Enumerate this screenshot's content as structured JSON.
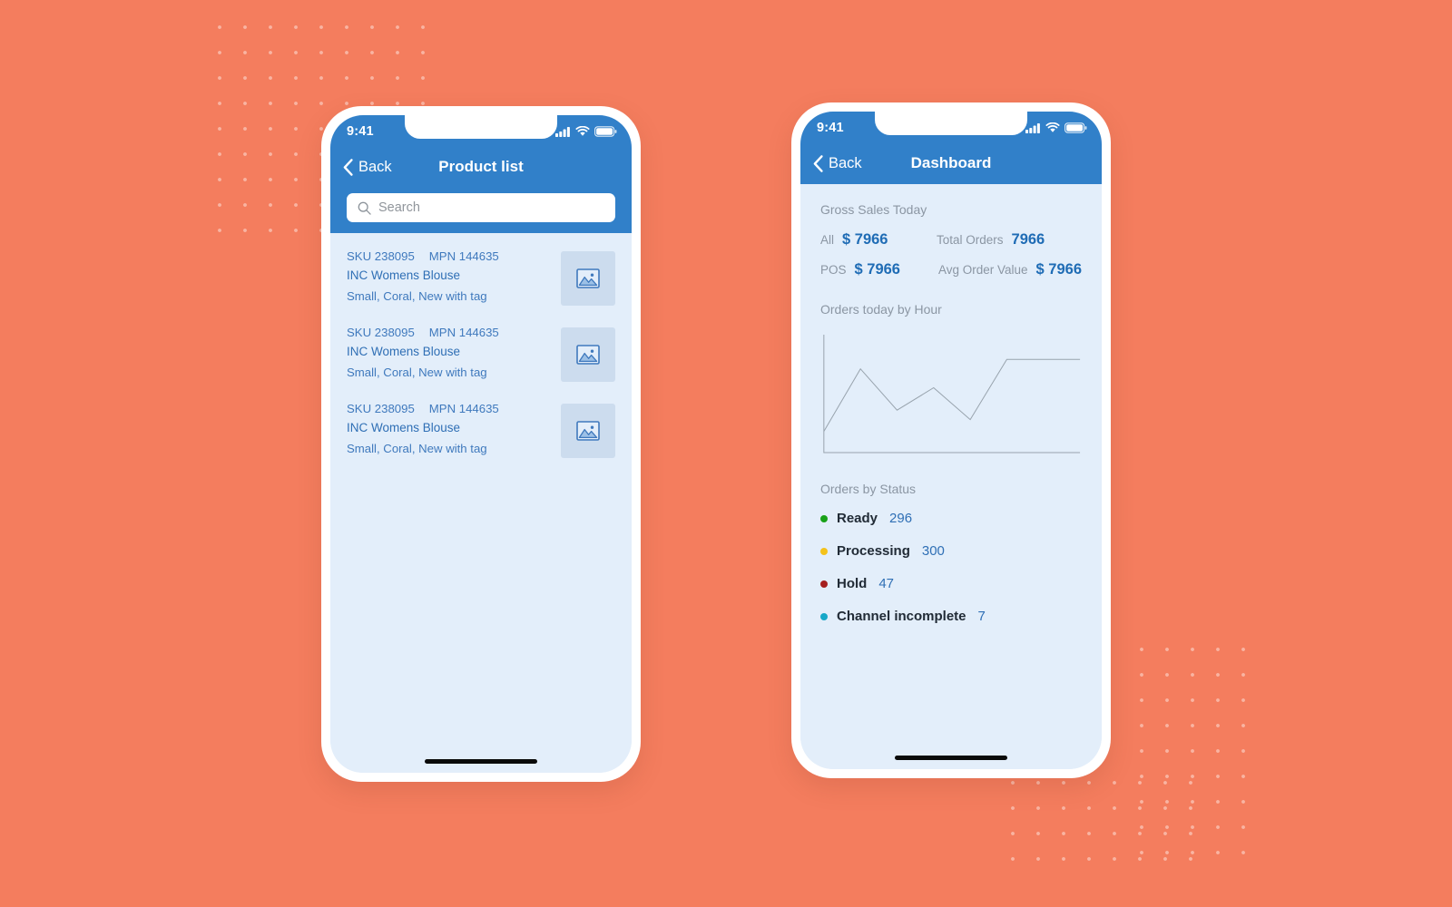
{
  "background": {
    "color": "#f47d5e",
    "dot_color": "rgba(255,255,255,0.42)"
  },
  "theme": {
    "header_blue": "#3180c9",
    "screen_bg": "#e3eefa",
    "link_blue": "#2f6fb5"
  },
  "phone_left": {
    "status_bar": {
      "time": "9:41",
      "icons": [
        "signal-icon",
        "wifi-icon",
        "battery-icon"
      ]
    },
    "nav": {
      "back_label": "Back",
      "title": "Product list"
    },
    "search": {
      "value": "",
      "placeholder": "Search",
      "icon": "search-icon"
    },
    "products": [
      {
        "sku_label": "SKU 238095",
        "mpn_label": "MPN 144635",
        "name": "INC Womens Blouse",
        "attributes": "Small, Coral, New with tag",
        "thumb_icon": "image-placeholder-icon"
      },
      {
        "sku_label": "SKU 238095",
        "mpn_label": "MPN 144635",
        "name": "INC Womens Blouse",
        "attributes": "Small, Coral, New with tag",
        "thumb_icon": "image-placeholder-icon"
      },
      {
        "sku_label": "SKU 238095",
        "mpn_label": "MPN 144635",
        "name": "INC Womens Blouse",
        "attributes": "Small, Coral, New with tag",
        "thumb_icon": "image-placeholder-icon"
      }
    ]
  },
  "phone_right": {
    "status_bar": {
      "time": "9:41",
      "icons": [
        "signal-icon",
        "wifi-icon",
        "battery-icon"
      ]
    },
    "nav": {
      "back_label": "Back",
      "title": "Dashboard"
    },
    "gross_sales": {
      "title": "Gross Sales Today",
      "metrics": [
        {
          "label": "All",
          "value": "$ 7966"
        },
        {
          "label": "Total Orders",
          "value": "7966"
        },
        {
          "label": "POS",
          "value": "$ 7966"
        },
        {
          "label": "Avg Order Value",
          "value": "$ 7966"
        }
      ]
    },
    "orders_chart": {
      "title": "Orders today by Hour"
    },
    "orders_by_status": {
      "title": "Orders by Status",
      "items": [
        {
          "label": "Ready",
          "count": "296",
          "color": "#18a118"
        },
        {
          "label": "Processing",
          "count": "300",
          "color": "#f4c21a"
        },
        {
          "label": "Hold",
          "count": "47",
          "color": "#a51f1f"
        },
        {
          "label": "Channel incomplete",
          "count": "7",
          "color": "#17a8c8"
        }
      ]
    }
  },
  "chart_data": {
    "type": "line",
    "title": "Orders today by Hour",
    "xlabel": "",
    "ylabel": "",
    "grid": false,
    "legend": "none",
    "axis_color": "#98a3ad",
    "line_color": "#98a3ad",
    "x": [
      0,
      1,
      2,
      3,
      4,
      5,
      6,
      7
    ],
    "values": [
      18,
      71,
      36,
      55,
      28,
      79,
      79,
      79
    ],
    "xlim": [
      0,
      7
    ],
    "ylim": [
      0,
      100
    ]
  }
}
